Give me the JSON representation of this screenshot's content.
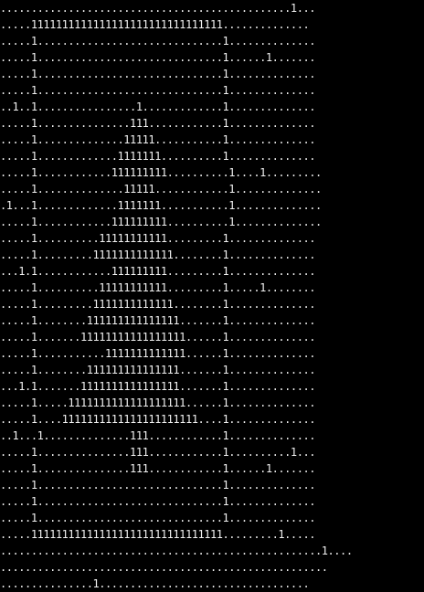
{
  "colors": {
    "background": "#000000",
    "text": "#f2f2f2"
  },
  "art": {
    "lines": [
      "...............................................1...",
      ".....1111111111111111111111111111111..............",
      ".....1..............................1..............",
      ".....1..............................1......1.......",
      ".....1..............................1..............",
      ".....1..............................1..............",
      "..1..1................1.............1..............",
      ".....1...............111............1..............",
      ".....1..............11111...........1..............",
      ".....1.............1111111..........1..............",
      ".....1............111111111..........1....1.........",
      ".....1..............11111............1..............",
      ".1...1.............1111111...........1..............",
      ".....1............111111111..........1..............",
      ".....1..........11111111111.........1..............",
      ".....1.........1111111111111........1..............",
      "...1.1............111111111.........1..............",
      ".....1..........11111111111.........1.....1........",
      ".....1.........1111111111111........1..............",
      ".....1........111111111111111.......1..............",
      ".....1.......11111111111111111......1..............",
      ".....1...........1111111111111......1..............",
      ".....1........111111111111111.......1..............",
      "...1.1.......1111111111111111.......1..............",
      ".....1.....1111111111111111111......1..............",
      ".....1....1111111111111111111111....1..............",
      "..1...1..............111............1..............",
      ".....1...............111............1..........1...",
      ".....1...............111............1......1.......",
      ".....1..............................1..............",
      ".....1..............................1..............",
      ".....1..............................1..............",
      ".....1111111111111111111111111111111.........1.....",
      "....................................................1....",
      ".....................................................",
      "...............1.................................."
    ]
  }
}
